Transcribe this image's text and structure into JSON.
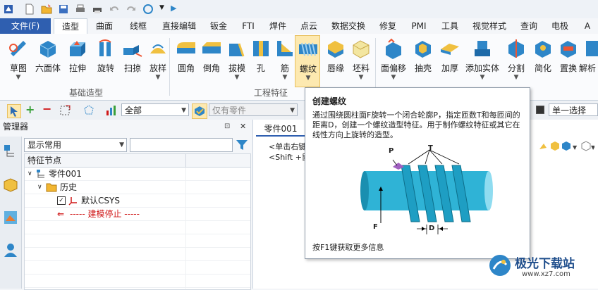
{
  "menu": {
    "file": "文件(F)",
    "tabs": [
      "造型",
      "曲面",
      "线框",
      "直接编辑",
      "钣金",
      "FTI",
      "焊件",
      "点云",
      "数据交换",
      "修复",
      "PMI",
      "工具",
      "视觉样式",
      "查询",
      "电极",
      "A"
    ],
    "active": "造型"
  },
  "ribbon": {
    "buttons": [
      {
        "label": "草图",
        "icon": "sketch-icon"
      },
      {
        "label": "六面体",
        "icon": "cube-icon"
      },
      {
        "label": "拉伸",
        "icon": "extrude-icon"
      },
      {
        "label": "旋转",
        "icon": "revolve-icon"
      },
      {
        "label": "扫掠",
        "icon": "sweep-icon"
      },
      {
        "label": "放样",
        "icon": "loft-icon"
      },
      {
        "label": "圆角",
        "icon": "fillet-icon"
      },
      {
        "label": "倒角",
        "icon": "chamfer-icon"
      },
      {
        "label": "拔模",
        "icon": "draft-icon"
      },
      {
        "label": "孔",
        "icon": "hole-icon"
      },
      {
        "label": "筋",
        "icon": "rib-icon"
      },
      {
        "label": "螺纹",
        "icon": "thread-icon"
      },
      {
        "label": "唇缘",
        "icon": "lip-icon"
      },
      {
        "label": "坯料",
        "icon": "stock-icon"
      },
      {
        "label": "面偏移",
        "icon": "face-offset-icon"
      },
      {
        "label": "抽壳",
        "icon": "shell-icon"
      },
      {
        "label": "加厚",
        "icon": "thicken-icon"
      },
      {
        "label": "添加实体",
        "icon": "add-solid-icon"
      },
      {
        "label": "分割",
        "icon": "split-icon"
      },
      {
        "label": "简化",
        "icon": "simplify-icon"
      },
      {
        "label": "置换",
        "icon": "replace-icon"
      },
      {
        "label": "解析",
        "icon": "analyze-icon"
      }
    ],
    "group1": "基础造型",
    "group2": "工程特征"
  },
  "toolbar2": {
    "filter_all": "全部",
    "only_parts": "仅有零件",
    "single_select": "单一选择"
  },
  "manager": {
    "title": "管理器",
    "pin": "📌",
    "close": "✕",
    "display": "显示常用",
    "column": "特征节点",
    "tree": {
      "part": "零件001",
      "history": "历史",
      "csys": "默认CSYS",
      "stop": "----- 建模停止 -----"
    }
  },
  "main": {
    "tab": "零件001",
    "hint1": "<单击右键",
    "hint2": "<Shift +鼠"
  },
  "tooltip": {
    "title": "创建螺纹",
    "desc": "通过围绕圆柱面F旋转一个闭合轮廓P，指定匝数T和每匝间的距离D，创建一个螺纹造型特征。用于制作螺纹特征或其它在线性方向上旋转的造型。",
    "lab_p": "P",
    "lab_t": "T",
    "lab_f": "F",
    "lab_d": "D",
    "footer": "按F1键获取更多信息"
  },
  "watermark": {
    "text": "极光下载站",
    "url": "www.xz7.com"
  },
  "colors": {
    "accent": "#2f5fb0",
    "red_text": "#d01818",
    "icon_blue": "#2e86c8",
    "thread_cyan": "#2fb3d6"
  }
}
